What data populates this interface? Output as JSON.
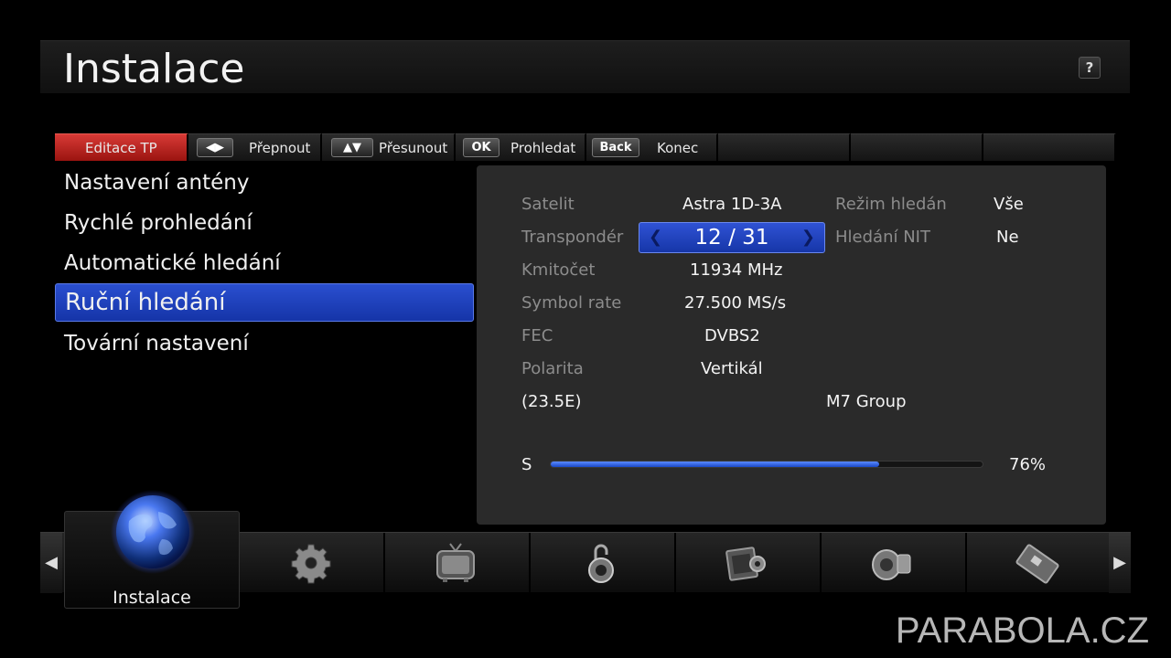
{
  "header": {
    "title": "Instalace",
    "help_label": "?"
  },
  "hint_bar": [
    {
      "key": "",
      "label": "Editace TP",
      "color": "#c62a24"
    },
    {
      "key": "◀▶",
      "label": "Přepnout"
    },
    {
      "key": "▲▼",
      "label": "Přesunout"
    },
    {
      "key": "OK",
      "label": "Prohledat"
    },
    {
      "key": "Back",
      "label": "Konec"
    }
  ],
  "menu": {
    "items": [
      {
        "label": "Nastavení antény"
      },
      {
        "label": "Rychlé prohledání"
      },
      {
        "label": "Automatické hledání"
      },
      {
        "label": "Ruční hledání",
        "selected": true
      },
      {
        "label": "Tovární nastavení"
      }
    ]
  },
  "panel": {
    "satellite_label": "Satelit",
    "satellite_value": "Astra 1D-3A",
    "search_mode_label": "Režim hledán",
    "search_mode_value": "Vše",
    "transponder_label": "Transpondér",
    "transponder_value": "12 / 31",
    "nit_label": "Hledání NIT",
    "nit_value": "Ne",
    "frequency_label": "Kmitočet",
    "frequency_value": "11934 MHz",
    "symbol_rate_label": "Symbol rate",
    "symbol_rate_value": "27.500 MS/s",
    "fec_label": "FEC",
    "fec_value": "DVBS2",
    "polarity_label": "Polarita",
    "polarity_value": "Vertikál",
    "position": "(23.5E)",
    "provider": "M7 Group",
    "signal_label": "S",
    "signal_percent": 76,
    "signal_text": "76%"
  },
  "dock": {
    "selected_caption": "Instalace",
    "icons": [
      "globe-icon",
      "gear-icon",
      "tv-icon",
      "lock-icon",
      "film-icon",
      "camera-icon",
      "card-icon"
    ]
  },
  "watermark": "PARABOLA.CZ",
  "colors": {
    "accent_blue": "#1e40c0",
    "red_tab": "#c62a24"
  }
}
